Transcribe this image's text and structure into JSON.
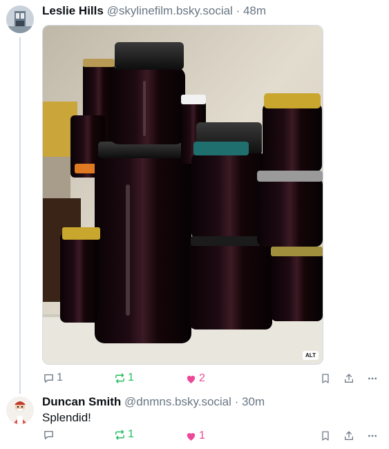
{
  "posts": [
    {
      "author": "Leslie Hills",
      "handle": "@skylinefilm.bsky.social",
      "time": "· 48m",
      "image_alt_badge": "ALT",
      "replies": "1",
      "reposts": "1",
      "likes": "2"
    },
    {
      "author": "Duncan Smith",
      "handle": "@dnmns.bsky.social",
      "time": "· 30m",
      "text": "Splendid!",
      "replies": "",
      "reposts": "1",
      "likes": "1"
    }
  ],
  "colors": {
    "repost": "#20bc5b",
    "like": "#ec4899",
    "muted": "#687684"
  },
  "icons": [
    "reply-icon",
    "repost-icon",
    "like-icon",
    "bookmark-icon",
    "share-icon",
    "more-icon"
  ]
}
